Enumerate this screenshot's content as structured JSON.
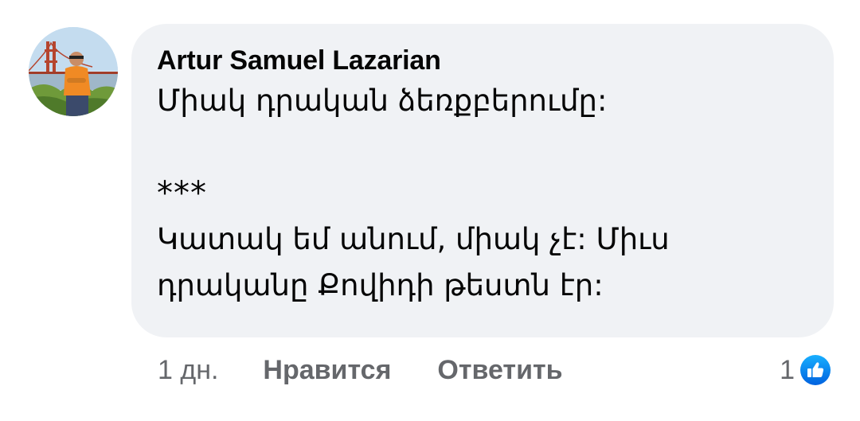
{
  "comment": {
    "author": "Artur Samuel Lazarian",
    "lines": [
      "Միակ դրական ձեռքբերումը:",
      "***",
      "Կատակ եմ անում, միակ չէ: Միւս",
      "դրականը Քովիդի թեստն էր:"
    ]
  },
  "footer": {
    "time": "1 дн.",
    "like_label": "Нравится",
    "reply_label": "Ответить",
    "reaction_count": "1",
    "reaction_icon": "like-icon"
  },
  "colors": {
    "bubble_bg": "#f0f2f5",
    "text": "#050505",
    "secondary_text": "#65676b",
    "like_blue": "#1877f2"
  }
}
